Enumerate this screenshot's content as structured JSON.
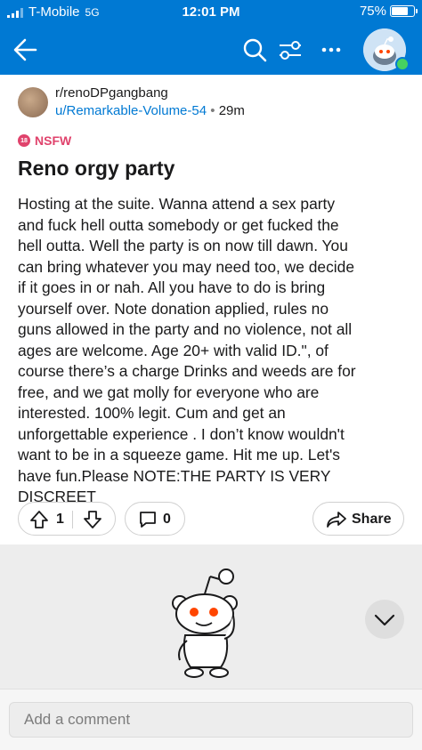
{
  "status_bar": {
    "carrier": "T-Mobile",
    "network": "5G",
    "time": "12:01 PM",
    "battery_percent": "75%",
    "battery_level": 0.75
  },
  "top_bar": {
    "icons": [
      "back-arrow-icon",
      "search-icon",
      "sort-icon",
      "more-icon",
      "avatar"
    ]
  },
  "post": {
    "subreddit": "r/renoDPgangbang",
    "author": "u/Remarkable-Volume-54",
    "separator": "•",
    "age": "29m",
    "nsfw_label": "NSFW",
    "nsfw_badge": "18",
    "title": "Reno orgy party",
    "body_lines": [
      "Hosting at the suite. Wanna attend a sex party",
      "and fuck hell outta somebody or get fucked the",
      "hell outta. Well the party is on now till dawn. You",
      "can bring whatever you may need too, we decide",
      "if it goes in or nah. All you have to do is bring",
      "yourself over. Note  donation applied, rules no",
      "guns allowed in the party and no violence, not all",
      "ages are welcome. Age 20+ with valid ID.\", of",
      "course there’s a charge Drinks and weeds are for",
      "free, and we gat molly for everyone who are",
      "interested. 100% legit. Cum and get an",
      "unforgettable experience . I don’t know wouldn't",
      "want to be in a squeeze game. Hit me up. Let's",
      "have fun.Please NOTE:THE PARTY IS VERY",
      "DISCREET"
    ]
  },
  "actions": {
    "vote_count": "1",
    "comment_count": "0",
    "share_label": "Share"
  },
  "comment_box": {
    "placeholder": "Add a comment"
  },
  "colors": {
    "brand_blue": "#0079d3",
    "nsfw_red": "#e0436c"
  }
}
